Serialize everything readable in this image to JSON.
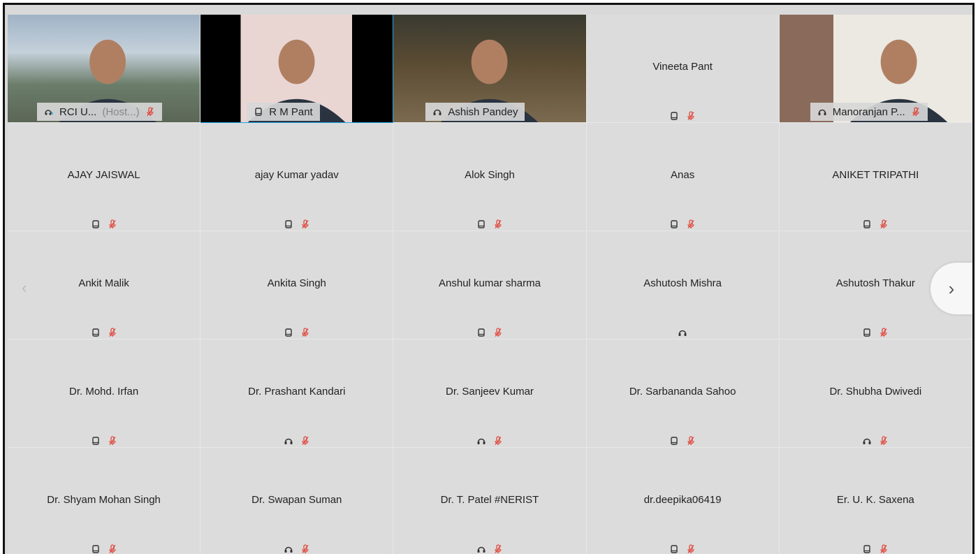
{
  "video_tiles": [
    {
      "name": "RCI U...",
      "host": "(Host...)",
      "icon": "cloud-audio-icon",
      "muted": true
    },
    {
      "name": "R M Pant",
      "icon": "phone-icon",
      "muted": false,
      "active": true
    },
    {
      "name": "Ashish Pandey",
      "icon": "headset-icon",
      "muted": false
    },
    {
      "name": "Vineeta Pant",
      "icon": "phone-icon",
      "muted": true,
      "no_video": true
    },
    {
      "name": "Manoranjan P...",
      "icon": "headset-icon",
      "muted": true
    }
  ],
  "participants": [
    {
      "name": "AJAY JAISWAL",
      "icon": "phone-icon",
      "muted": true
    },
    {
      "name": "ajay Kumar yadav",
      "icon": "phone-icon",
      "muted": true
    },
    {
      "name": "Alok Singh",
      "icon": "phone-icon",
      "muted": true
    },
    {
      "name": "Anas",
      "icon": "phone-icon",
      "muted": true
    },
    {
      "name": "ANIKET TRIPATHI",
      "icon": "phone-icon",
      "muted": true
    },
    {
      "name": "Ankit Malik",
      "icon": "phone-icon",
      "muted": true
    },
    {
      "name": "Ankita Singh",
      "icon": "phone-icon",
      "muted": true
    },
    {
      "name": "Anshul kumar sharma",
      "icon": "phone-icon",
      "muted": true
    },
    {
      "name": "Ashutosh Mishra",
      "icon": "headset-icon",
      "muted": false
    },
    {
      "name": "Ashutosh Thakur",
      "icon": "phone-icon",
      "muted": true
    },
    {
      "name": "Dr. Mohd. Irfan",
      "icon": "phone-icon",
      "muted": true
    },
    {
      "name": "Dr. Prashant Kandari",
      "icon": "headset-icon",
      "muted": true
    },
    {
      "name": "Dr. Sanjeev Kumar",
      "icon": "headset-icon",
      "muted": true
    },
    {
      "name": "Dr. Sarbananda Sahoo",
      "icon": "phone-icon",
      "muted": true
    },
    {
      "name": "Dr. Shubha Dwivedi",
      "icon": "headset-icon",
      "muted": true
    },
    {
      "name": "Dr. Shyam Mohan Singh",
      "icon": "phone-icon",
      "muted": true
    },
    {
      "name": "Dr. Swapan Suman",
      "icon": "headset-icon",
      "muted": true
    },
    {
      "name": "Dr. T. Patel #NERIST",
      "icon": "headset-icon",
      "muted": true
    },
    {
      "name": "dr.deepika06419",
      "icon": "phone-icon",
      "muted": true
    },
    {
      "name": "Er. U. K. Saxena",
      "icon": "phone-icon",
      "muted": true
    }
  ],
  "nav": {
    "prev": "‹",
    "next": "›"
  },
  "colors": {
    "active_border": "#1ea7e8",
    "muted_red": "#e0453a",
    "tile_bg": "#dcdcdc"
  }
}
